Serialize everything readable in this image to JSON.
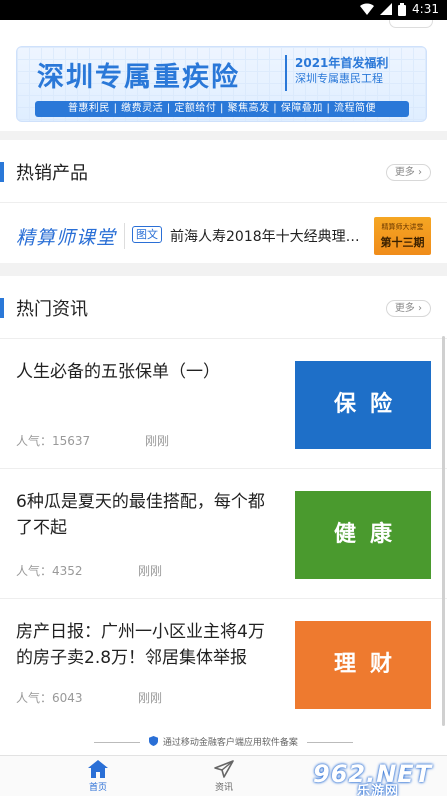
{
  "status_bar": {
    "time": "4:31"
  },
  "banner": {
    "title": "深圳专属重疾险",
    "right_line1": "2021年首发福利",
    "right_line2": "深圳专属惠民工程",
    "tags": "普惠利民 | 缴费灵活 | 定额给付 | 聚焦高发 | 保障叠加 | 流程简便"
  },
  "hot_products": {
    "title": "热销产品",
    "more_label": "更多",
    "brand": "精算师课堂",
    "tag": "图文",
    "item_title": "前海人寿2018年十大经典理…",
    "thumb_line1": "精算师大讲堂",
    "thumb_line2": "第十三期"
  },
  "hot_news": {
    "title": "热门资讯",
    "more_label": "更多",
    "items": [
      {
        "title": "人生必备的五张保单（一）",
        "views": "人气：15637",
        "time": "刚刚",
        "image_label": "保险",
        "image_color": "#1e6fc8"
      },
      {
        "title": "6种瓜是夏天的最佳搭配，每个都了不起",
        "views": "人气：4352",
        "time": "刚刚",
        "image_label": "健康",
        "image_color": "#4a9a2e"
      },
      {
        "title": "房产日报：广州一小区业主将4万的房子卖2.8万！邻居集体举报",
        "views": "人气：6043",
        "time": "刚刚",
        "image_label": "理财",
        "image_color": "#ee7a2f"
      }
    ]
  },
  "footer_note": "通过移动金融客户端应用软件备案",
  "tabs": {
    "home": "首页",
    "news": "资讯"
  },
  "watermark": {
    "line1": "962.NET",
    "line2": "乐游网"
  },
  "colors": {
    "accent": "#2a6fd6"
  }
}
